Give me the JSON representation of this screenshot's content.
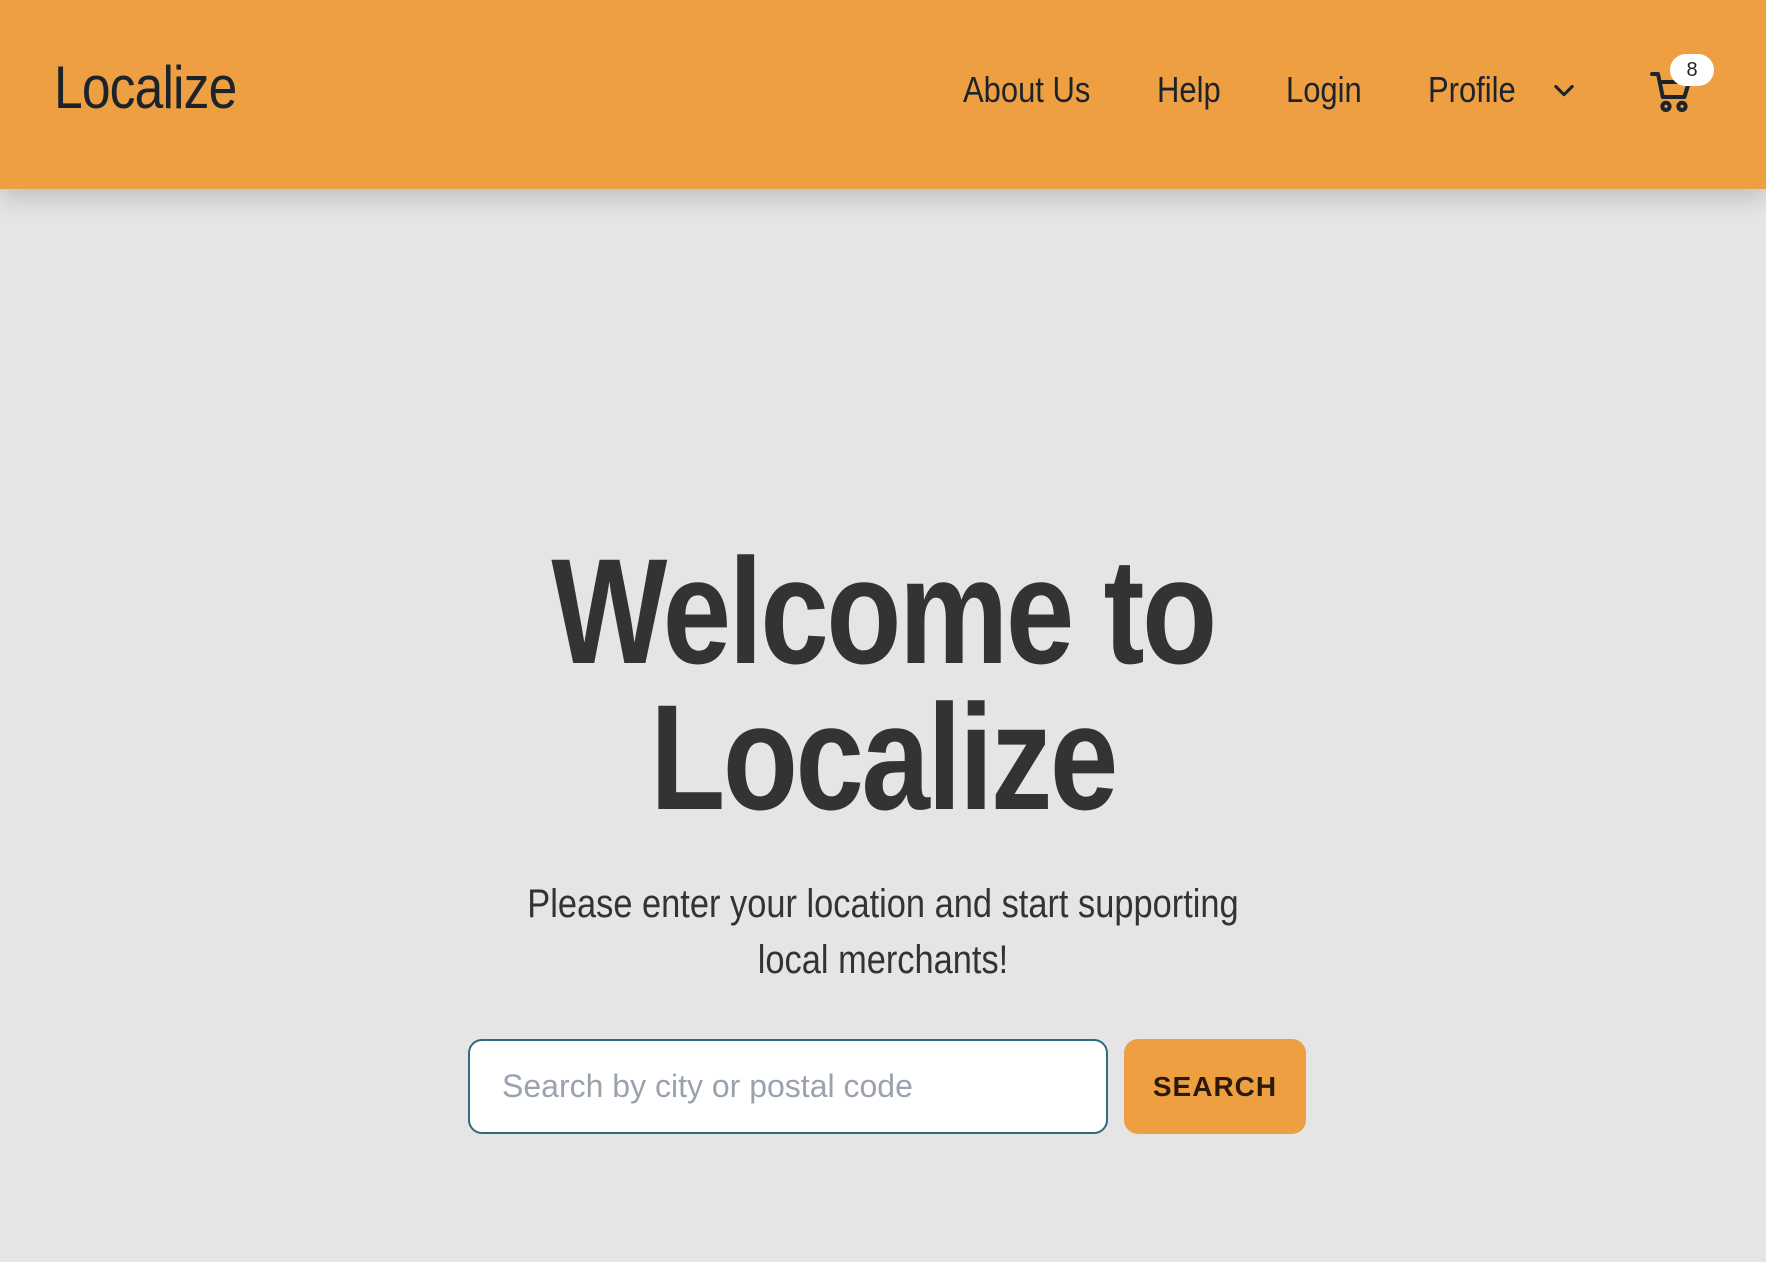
{
  "header": {
    "brand": "Localize",
    "nav": {
      "about": "About Us",
      "help": "Help",
      "login": "Login",
      "profile": "Profile"
    },
    "profile_dropdown_icon": "chevron-down-icon",
    "cart": {
      "icon": "shopping-cart-icon",
      "count": "8"
    }
  },
  "hero": {
    "title": "Welcome to Localize",
    "subtitle": "Please enter your location and start supporting local merchants!"
  },
  "search": {
    "placeholder": "Search by city or postal code",
    "value": "",
    "button_label": "SEARCH"
  },
  "colors": {
    "header_bg": "#ee9f41",
    "page_bg": "#e5e5e5",
    "button_bg": "#ee9f41",
    "input_border": "#2f6b80",
    "text": "#333333"
  }
}
